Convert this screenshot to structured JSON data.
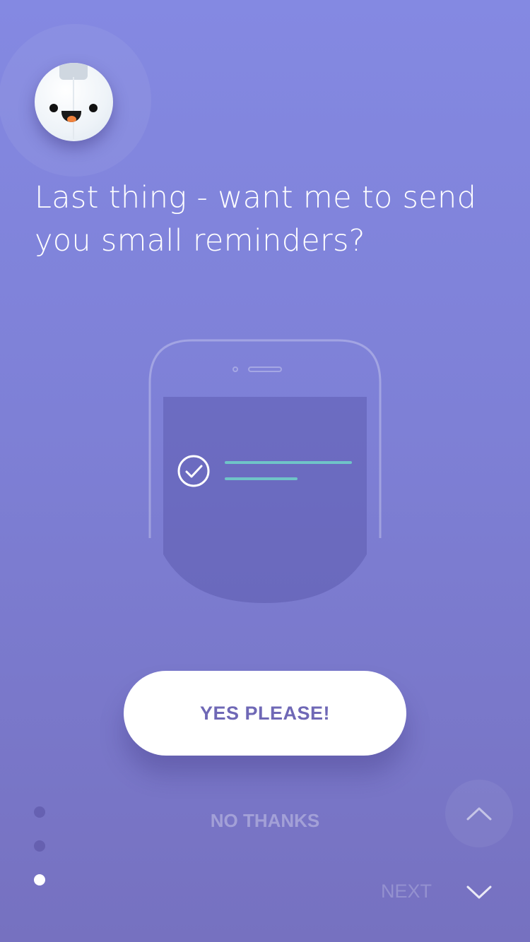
{
  "mascot": {
    "icon": "mascot-face-icon"
  },
  "headline": "Last thing - want me to send you small reminders?",
  "illustration": {
    "phone_icon": "phone-icon",
    "check_icon": "check-circle-icon",
    "accent_line_color": "#6fc4c8"
  },
  "primary_action": {
    "label": "YES PLEASE!"
  },
  "secondary_action": {
    "label": "NO THANKS"
  },
  "pagination": {
    "total": 3,
    "current": 3
  },
  "navigation": {
    "next_label": "NEXT",
    "up_icon": "chevron-up-icon",
    "down_icon": "chevron-down-icon"
  }
}
